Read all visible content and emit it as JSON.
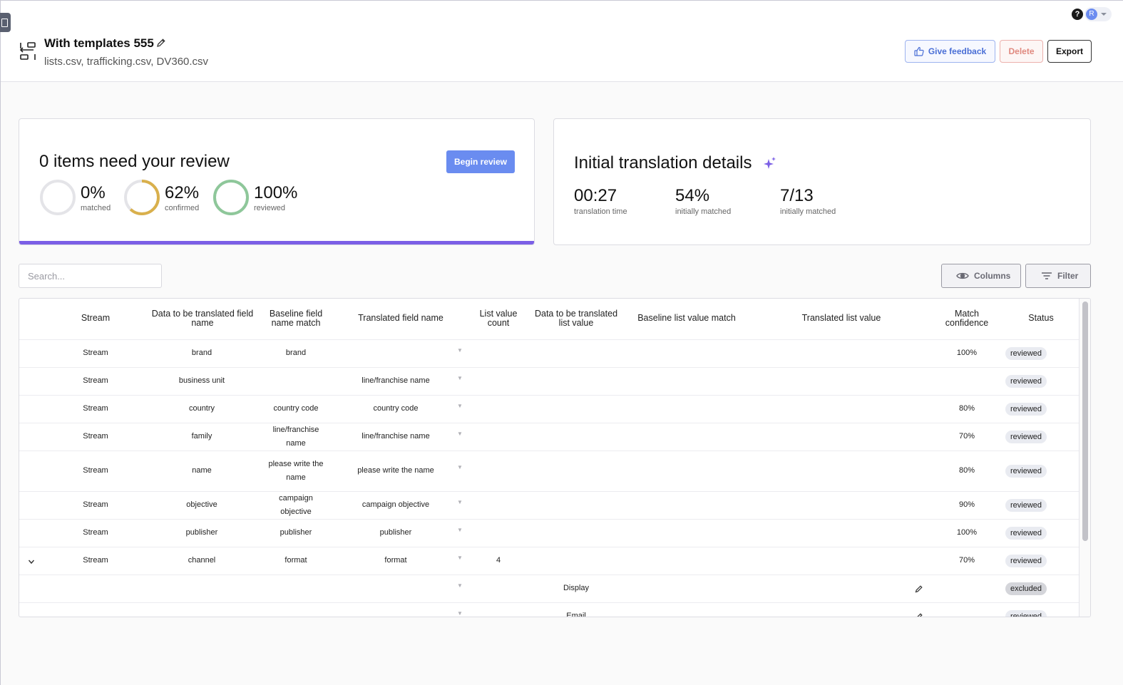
{
  "header": {
    "title": "With templates 555",
    "subtitle": "lists.csv, trafficking.csv, DV360.csv",
    "feedback_label": "Give feedback",
    "delete_label": "Delete",
    "export_label": "Export",
    "avatar_initial": "R",
    "help_glyph": "?"
  },
  "review_card": {
    "heading": "0 items need your review",
    "begin_label": "Begin review",
    "accent_color": "#7b5fe6",
    "metrics": [
      {
        "value": "0%",
        "label": "matched",
        "fraction": 0,
        "color": "#e4e4e8"
      },
      {
        "value": "62%",
        "label": "confirmed",
        "fraction": 0.62,
        "color": "#d9b04c"
      },
      {
        "value": "100%",
        "label": "reviewed",
        "fraction": 1.0,
        "color": "#8ec79a"
      }
    ]
  },
  "initial_card": {
    "heading": "Initial translation details",
    "stats": [
      {
        "value": "00:27",
        "label": "translation time"
      },
      {
        "value": "54%",
        "label": "initially matched"
      },
      {
        "value": "7/13",
        "label": "initially matched"
      }
    ]
  },
  "toolbar": {
    "search_placeholder": "Search...",
    "columns_label": "Columns",
    "filter_label": "Filter"
  },
  "table": {
    "headers": {
      "stream": "Stream",
      "data_field": "Data to be translated field name",
      "baseline_field": "Baseline field name match",
      "translated_field": "Translated field name",
      "list_count": "List value count",
      "data_list_value": "Data to be translated list value",
      "baseline_list_value": "Baseline list value match",
      "translated_list_value": "Translated list value",
      "match_confidence": "Match confidence",
      "status": "Status"
    },
    "rows": [
      {
        "stream": "Stream",
        "data_field": "brand",
        "baseline": "brand",
        "translated": "",
        "count": "",
        "list_value": "",
        "confidence": "100%",
        "status": "reviewed"
      },
      {
        "stream": "Stream",
        "data_field": "business unit",
        "baseline": "",
        "translated": "line/franchise name",
        "count": "",
        "list_value": "",
        "confidence": "",
        "status": "reviewed"
      },
      {
        "stream": "Stream",
        "data_field": "country",
        "baseline": "country code",
        "translated": "country code",
        "count": "",
        "list_value": "",
        "confidence": "80%",
        "status": "reviewed"
      },
      {
        "stream": "Stream",
        "data_field": "family",
        "baseline": "line/franchise name",
        "translated": "line/franchise name",
        "count": "",
        "list_value": "",
        "confidence": "70%",
        "status": "reviewed"
      },
      {
        "stream": "Stream",
        "data_field": "name",
        "baseline": "please write the name",
        "translated": "please write the name",
        "count": "",
        "list_value": "",
        "confidence": "80%",
        "status": "reviewed"
      },
      {
        "stream": "Stream",
        "data_field": "objective",
        "baseline": "campaign objective",
        "translated": "campaign objective",
        "count": "",
        "list_value": "",
        "confidence": "90%",
        "status": "reviewed"
      },
      {
        "stream": "Stream",
        "data_field": "publisher",
        "baseline": "publisher",
        "translated": "publisher",
        "count": "",
        "list_value": "",
        "confidence": "100%",
        "status": "reviewed"
      },
      {
        "stream": "Stream",
        "data_field": "channel",
        "baseline": "format",
        "translated": "format",
        "count": "4",
        "list_value": "",
        "confidence": "70%",
        "status": "reviewed"
      },
      {
        "stream": "",
        "data_field": "",
        "baseline": "",
        "translated": "",
        "count": "",
        "list_value": "Display",
        "confidence": "",
        "status": "excluded"
      },
      {
        "stream": "",
        "data_field": "",
        "baseline": "",
        "translated": "",
        "count": "",
        "list_value": "Email",
        "confidence": "",
        "status": "reviewed"
      }
    ]
  }
}
